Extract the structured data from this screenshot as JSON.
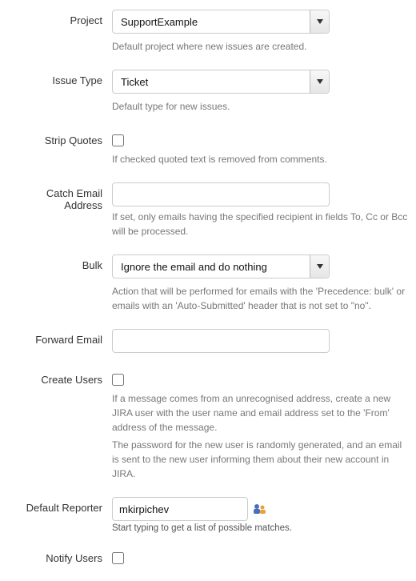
{
  "project": {
    "label": "Project",
    "value": "SupportExample",
    "helper": "Default project where new issues are created."
  },
  "issueType": {
    "label": "Issue Type",
    "value": "Ticket",
    "helper": "Default type for new issues."
  },
  "stripQuotes": {
    "label": "Strip Quotes",
    "helper": "If checked quoted text is removed from comments."
  },
  "catchEmail": {
    "label": "Catch Email Address",
    "value": "",
    "helper": "If set, only emails having the specified recipient in fields To, Cc or Bcc will be processed."
  },
  "bulk": {
    "label": "Bulk",
    "value": "Ignore the email and do nothing",
    "helper": "Action that will be performed for emails with the 'Precedence: bulk' or emails with an 'Auto-Submitted' header that is not set to \"no\"."
  },
  "forwardEmail": {
    "label": "Forward Email",
    "value": ""
  },
  "createUsers": {
    "label": "Create Users",
    "helper1": "If a message comes from an unrecognised address, create a new JIRA user with the user name and email address set to the 'From' address of the message.",
    "helper2": "The password for the new user is randomly generated, and an email is sent to the new user informing them about their new account in JIRA."
  },
  "defaultReporter": {
    "label": "Default Reporter",
    "value": "mkirpichev",
    "helper": "Start typing to get a list of possible matches."
  },
  "notifyUsers": {
    "label": "Notify Users"
  }
}
